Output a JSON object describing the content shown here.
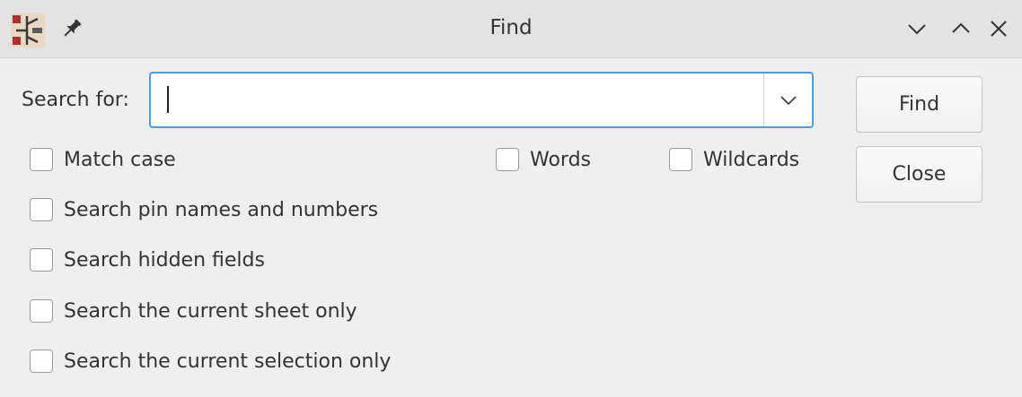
{
  "window": {
    "title": "Find",
    "icons": {
      "app": "kicad-schematic-app-icon",
      "pin": "pin-icon",
      "minimize": "chevron-down-icon",
      "maximize": "chevron-up-icon",
      "close": "close-icon"
    }
  },
  "search": {
    "label": "Search for:",
    "value": "",
    "placeholder": "",
    "dropdown_icon": "chevron-down-icon"
  },
  "options": {
    "match_case": {
      "label": "Match case",
      "checked": false
    },
    "words": {
      "label": "Words",
      "checked": false
    },
    "wildcards": {
      "label": "Wildcards",
      "checked": false
    },
    "pin_names": {
      "label": "Search pin names and numbers",
      "checked": false
    },
    "hidden_fields": {
      "label": "Search hidden fields",
      "checked": false
    },
    "current_sheet": {
      "label": "Search the current sheet only",
      "checked": false
    },
    "current_selection": {
      "label": "Search the current selection only",
      "checked": false
    }
  },
  "buttons": {
    "find": "Find",
    "close": "Close"
  },
  "colors": {
    "focus_border": "#4a9de6",
    "background": "#efefef",
    "titlebar": "#e3e3e3"
  }
}
